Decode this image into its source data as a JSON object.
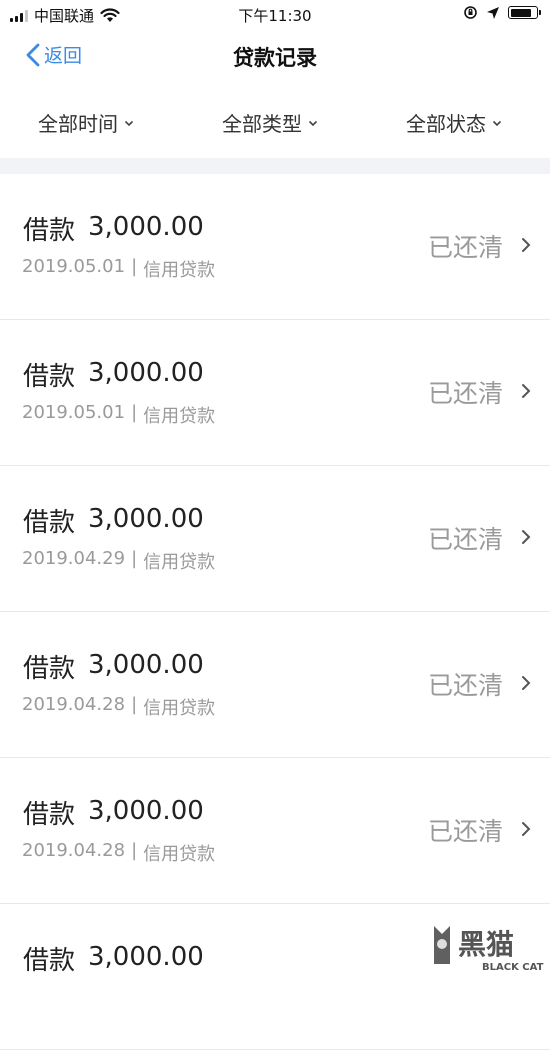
{
  "status_bar": {
    "carrier": "中国联通",
    "time": "下午11:30",
    "battery_level": 0.82
  },
  "nav": {
    "back_label": "返回",
    "title": "贷款记录"
  },
  "filters": [
    {
      "label": "全部时间"
    },
    {
      "label": "全部类型"
    },
    {
      "label": "全部状态"
    }
  ],
  "records": [
    {
      "type": "借款",
      "amount": "3,000.00",
      "date": "2019.05.01",
      "separator": "|",
      "category": "信用贷款",
      "status": "已还清"
    },
    {
      "type": "借款",
      "amount": "3,000.00",
      "date": "2019.05.01",
      "separator": "|",
      "category": "信用贷款",
      "status": "已还清"
    },
    {
      "type": "借款",
      "amount": "3,000.00",
      "date": "2019.04.29",
      "separator": "|",
      "category": "信用贷款",
      "status": "已还清"
    },
    {
      "type": "借款",
      "amount": "3,000.00",
      "date": "2019.04.28",
      "separator": "|",
      "category": "信用贷款",
      "status": "已还清"
    },
    {
      "type": "借款",
      "amount": "3,000.00",
      "date": "2019.04.28",
      "separator": "|",
      "category": "信用贷款",
      "status": "已还清"
    },
    {
      "type": "借款",
      "amount": "3,000.00",
      "date": "",
      "separator": "",
      "category": "",
      "status": ""
    }
  ],
  "watermark": {
    "text": "黑猫",
    "sub": "BLACK CAT"
  },
  "colors": {
    "accent": "#3a8ae6",
    "muted": "#9a9a9a",
    "band": "#f1f3f6"
  }
}
